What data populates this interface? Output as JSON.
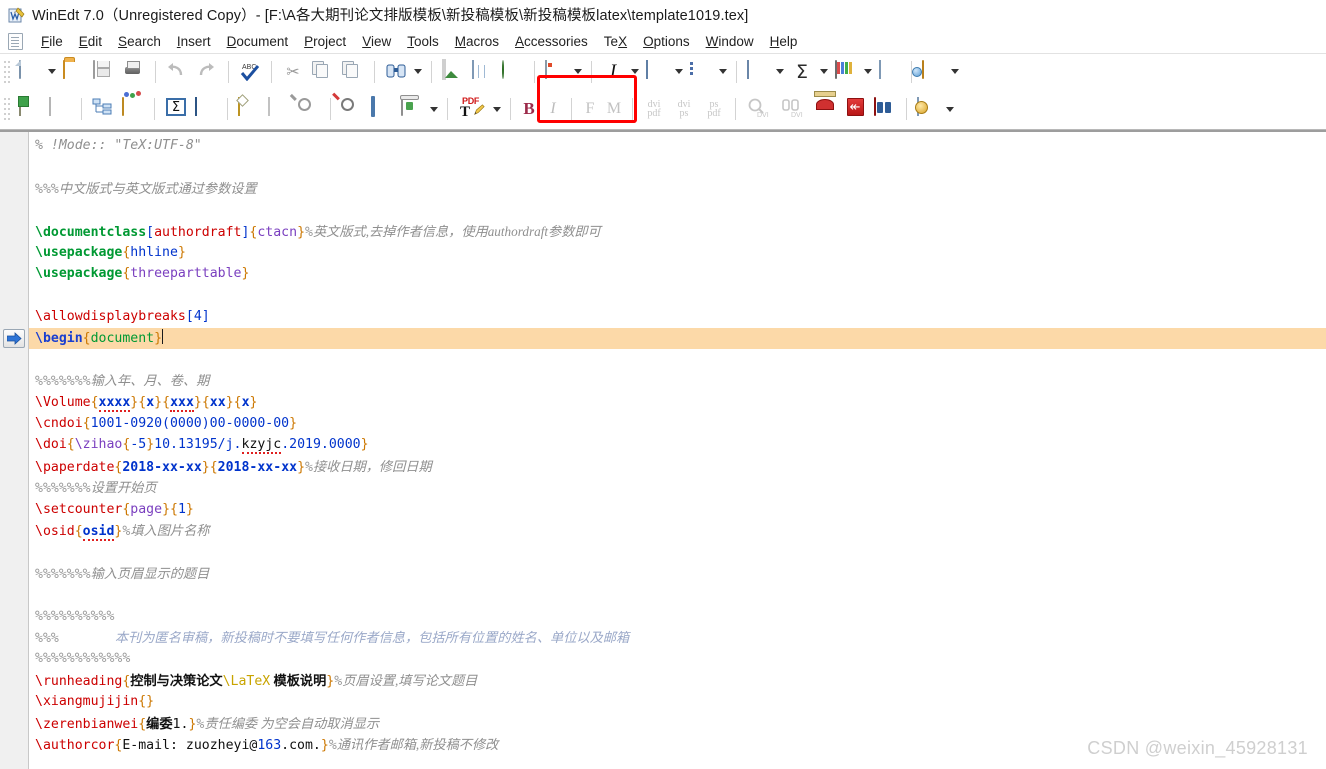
{
  "window": {
    "title": "WinEdt 7.0（Unregistered Copy）- [F:\\A各大期刊论文排版模板\\新投稿模板\\新投稿模板latex\\template1019.tex]",
    "app_icon": "winedt-icon"
  },
  "menubar": {
    "doc_icon": "document-icon",
    "items": [
      {
        "label": "File",
        "accel": "F"
      },
      {
        "label": "Edit",
        "accel": "E"
      },
      {
        "label": "Search",
        "accel": "S"
      },
      {
        "label": "Insert",
        "accel": "I"
      },
      {
        "label": "Document",
        "accel": "D"
      },
      {
        "label": "Project",
        "accel": "P"
      },
      {
        "label": "View",
        "accel": "V"
      },
      {
        "label": "Tools",
        "accel": "T"
      },
      {
        "label": "Macros",
        "accel": "M"
      },
      {
        "label": "Accessories",
        "accel": "A"
      },
      {
        "label": "TeX",
        "accel": "X"
      },
      {
        "label": "Options",
        "accel": "O"
      },
      {
        "label": "Window",
        "accel": "W"
      },
      {
        "label": "Help",
        "accel": "H"
      }
    ]
  },
  "toolbar_row1": {
    "buttons": [
      {
        "name": "new-document-button",
        "icon": "new-page-icon",
        "dropdown": true
      },
      {
        "name": "open-document-button",
        "icon": "open-folder-icon",
        "dropdown": false
      },
      {
        "name": "save-document-button",
        "icon": "save-disk-icon",
        "dropdown": false
      },
      {
        "name": "print-document-button",
        "icon": "printer-icon",
        "dropdown": false
      },
      {
        "name": "undo-button",
        "icon": "undo-arrow-icon",
        "dropdown": false
      },
      {
        "name": "redo-button",
        "icon": "redo-arrow-icon",
        "dropdown": false
      },
      {
        "name": "spell-check-button",
        "icon": "abc-checkmark-icon",
        "dropdown": false
      },
      {
        "name": "cut-button",
        "icon": "scissors-icon",
        "dropdown": false
      },
      {
        "name": "copy-button",
        "icon": "copy-pages-icon",
        "dropdown": false
      },
      {
        "name": "paste-button",
        "icon": "clipboard-icon",
        "dropdown": false
      },
      {
        "name": "find-replace-button",
        "icon": "binoculars-icon",
        "dropdown": true
      },
      {
        "name": "insert-image-button",
        "icon": "picture-icon",
        "dropdown": false
      },
      {
        "name": "insert-table-button",
        "icon": "table-icon",
        "dropdown": false
      },
      {
        "name": "insert-url-button",
        "icon": "globe-link-icon",
        "dropdown": false
      },
      {
        "name": "document-style-button",
        "icon": "styled-doc-icon",
        "dropdown": true
      },
      {
        "name": "italic-style-button",
        "icon": "italic-i-icon",
        "dropdown": true
      },
      {
        "name": "paragraph-align-button",
        "icon": "align-lines-icon",
        "dropdown": true
      },
      {
        "name": "list-environment-button",
        "icon": "bullet-list-icon",
        "dropdown": true
      },
      {
        "name": "tabular-wizard-button",
        "icon": "grid-table-icon",
        "dropdown": true
      },
      {
        "name": "math-symbol-button",
        "icon": "sigma-icon",
        "dropdown": true
      },
      {
        "name": "bibliography-button",
        "icon": "open-book-icon",
        "dropdown": true
      },
      {
        "name": "notes-button",
        "icon": "note-lines-icon",
        "dropdown": false
      },
      {
        "name": "project-folder-button",
        "icon": "folder-explore-icon",
        "dropdown": true
      }
    ]
  },
  "toolbar_row2": {
    "buttons": [
      {
        "name": "new-tex-document-button",
        "icon": "new-doc-plus-icon",
        "label": "",
        "state": "enabled"
      },
      {
        "name": "duplicate-doc-button",
        "icon": "gray-doc-icon",
        "label": "",
        "state": "disabled"
      },
      {
        "name": "document-tree-button",
        "icon": "tree-outline-icon",
        "label": "",
        "state": "enabled"
      },
      {
        "name": "package-wizard-button",
        "icon": "open-box-icon",
        "label": "",
        "state": "enabled"
      },
      {
        "name": "math-mode-button",
        "icon": "sigma-box-icon",
        "label": "",
        "state": "enabled"
      },
      {
        "name": "tex-preview-button",
        "icon": "blue-window-a-icon",
        "label": "",
        "state": "enabled"
      },
      {
        "name": "insert-table-wizard",
        "icon": "gold-grid-icon",
        "label": "",
        "state": "enabled"
      },
      {
        "name": "table-tools-button",
        "icon": "gray-grid-icon",
        "label": "",
        "state": "disabled"
      },
      {
        "name": "zoom-button",
        "icon": "magnifier-icon",
        "label": "",
        "state": "disabled"
      },
      {
        "name": "find-error-button",
        "icon": "magnifier-red-icon",
        "label": "",
        "state": "enabled"
      },
      {
        "name": "log-window-button",
        "icon": "blue-screen-icon",
        "label": "",
        "state": "enabled"
      },
      {
        "name": "clean-aux-button",
        "icon": "recycle-bin-icon",
        "label": "",
        "state": "enabled",
        "dropdown": true
      },
      {
        "name": "pdftexify-button",
        "icon": "pdf-texify-icon",
        "label": "PDF",
        "state": "enabled",
        "dropdown": true,
        "highlighted": true
      },
      {
        "name": "bibtex-button",
        "icon": "bold-b-icon",
        "label": "B",
        "state": "enabled"
      },
      {
        "name": "index-button",
        "icon": "italic-i-icon",
        "label": "I",
        "state": "disabled"
      },
      {
        "name": "makeindex-f-button",
        "icon": "letter-f-icon",
        "label": "F",
        "state": "disabled"
      },
      {
        "name": "makeindex-m-button",
        "icon": "letter-m-icon",
        "label": "M",
        "state": "disabled"
      },
      {
        "name": "dvi-to-pdf-button",
        "icon": "dvi-pdf-icon",
        "label": "dvi pdf",
        "state": "disabled"
      },
      {
        "name": "dvi-to-ps-button",
        "icon": "dvi-ps-icon",
        "label": "dvi ps",
        "state": "disabled"
      },
      {
        "name": "ps-to-pdf-button",
        "icon": "ps-pdf-icon",
        "label": "ps pdf",
        "state": "disabled"
      },
      {
        "name": "dvi-preview-button",
        "icon": "magnifier-dvi-icon",
        "label": "DVI",
        "state": "disabled"
      },
      {
        "name": "dvi-search-button",
        "icon": "binoculars-dvi-icon",
        "label": "DVI",
        "state": "disabled"
      },
      {
        "name": "dvi-print-button",
        "icon": "dvi-print-icon",
        "label": "",
        "state": "enabled"
      },
      {
        "name": "pdf-preview-button",
        "icon": "pdf-red-icon",
        "label": "",
        "state": "enabled"
      },
      {
        "name": "pdf-search-button",
        "icon": "pdf-binoculars-icon",
        "label": "",
        "state": "enabled"
      },
      {
        "name": "execution-modes-button",
        "icon": "gear-doc-icon",
        "label": "",
        "state": "enabled",
        "dropdown": true
      }
    ]
  },
  "editor": {
    "current_line_index": 8,
    "gutter_marker_icon": "blue-arrow-icon",
    "lines": [
      {
        "i": 0,
        "segments": [
          {
            "t": "% !Mode:: \"TeX:UTF-8\"",
            "c": "cmt"
          }
        ]
      },
      {
        "i": 1,
        "segments": []
      },
      {
        "i": 2,
        "segments": [
          {
            "t": "%%%",
            "c": "pct"
          },
          {
            "t": "中文版式与英文版式通过参数设置",
            "c": "cmt-zh"
          }
        ]
      },
      {
        "i": 3,
        "segments": []
      },
      {
        "i": 4,
        "segments": [
          {
            "t": "\\documentclass",
            "c": "cmd-g"
          },
          {
            "t": "[",
            "c": "brk"
          },
          {
            "t": "authordraft",
            "c": "opt"
          },
          {
            "t": "]",
            "c": "brk"
          },
          {
            "t": "{",
            "c": "brace"
          },
          {
            "t": "ctacn",
            "c": "arg"
          },
          {
            "t": "}",
            "c": "brace"
          },
          {
            "t": "%",
            "c": "pct"
          },
          {
            "t": "英文版式,去掉作者信息，使用authordraft参数即可",
            "c": "cmt-zh"
          }
        ]
      },
      {
        "i": 5,
        "segments": [
          {
            "t": "\\usepackage",
            "c": "cmd-g"
          },
          {
            "t": "{",
            "c": "brace"
          },
          {
            "t": "hhline",
            "c": "brk"
          },
          {
            "t": "}",
            "c": "brace"
          }
        ]
      },
      {
        "i": 6,
        "segments": [
          {
            "t": "\\usepackage",
            "c": "cmd-g"
          },
          {
            "t": "{",
            "c": "brace"
          },
          {
            "t": "threeparttable",
            "c": "arg"
          },
          {
            "t": "}",
            "c": "brace"
          }
        ]
      },
      {
        "i": 7,
        "segments": []
      },
      {
        "i": 8,
        "segments": [
          {
            "t": "\\allowdisplaybreaks",
            "c": "cmd"
          },
          {
            "t": "[",
            "c": "brk"
          },
          {
            "t": "4",
            "c": "num"
          },
          {
            "t": "]",
            "c": "brk"
          }
        ]
      },
      {
        "i": 9,
        "segments": [
          {
            "t": "\\begin",
            "c": "blu"
          },
          {
            "t": "{",
            "c": "brace"
          },
          {
            "t": "document",
            "c": "grn"
          },
          {
            "t": "}",
            "c": "brace"
          }
        ],
        "current": true,
        "caret": true
      },
      {
        "i": 10,
        "segments": []
      },
      {
        "i": 11,
        "segments": [
          {
            "t": "%%%%%%%",
            "c": "pct"
          },
          {
            "t": "输入年、月、卷、期",
            "c": "cmt-zh"
          }
        ]
      },
      {
        "i": 12,
        "segments": [
          {
            "t": "\\Volume",
            "c": "cmd"
          },
          {
            "t": "{",
            "c": "brace"
          },
          {
            "t": "xxxx",
            "c": "argb",
            "spell": true
          },
          {
            "t": "}",
            "c": "brace"
          },
          {
            "t": "{",
            "c": "brace"
          },
          {
            "t": "x",
            "c": "argb"
          },
          {
            "t": "}",
            "c": "brace"
          },
          {
            "t": "{",
            "c": "brace"
          },
          {
            "t": "xxx",
            "c": "argb",
            "spell": true
          },
          {
            "t": "}",
            "c": "brace"
          },
          {
            "t": "{",
            "c": "brace"
          },
          {
            "t": "xx",
            "c": "argb"
          },
          {
            "t": "}",
            "c": "brace"
          },
          {
            "t": "{",
            "c": "brace"
          },
          {
            "t": "x",
            "c": "argb"
          },
          {
            "t": "}",
            "c": "brace"
          }
        ]
      },
      {
        "i": 13,
        "segments": [
          {
            "t": "\\cndoi",
            "c": "cmd"
          },
          {
            "t": "{",
            "c": "brace"
          },
          {
            "t": "1001-0920(0000)00-0000-00",
            "c": "num"
          },
          {
            "t": "}",
            "c": "brace"
          }
        ]
      },
      {
        "i": 14,
        "segments": [
          {
            "t": "\\doi",
            "c": "cmd"
          },
          {
            "t": "{",
            "c": "brace"
          },
          {
            "t": "\\zihao",
            "c": "arg"
          },
          {
            "t": "{",
            "c": "brace"
          },
          {
            "t": "-5",
            "c": "num"
          },
          {
            "t": "}",
            "c": "brace"
          },
          {
            "t": "10.13195/j.",
            "c": "num"
          },
          {
            "t": "kzyjc",
            "c": "plain",
            "spell": true
          },
          {
            "t": ".2019.0000",
            "c": "num"
          },
          {
            "t": "}",
            "c": "brace"
          }
        ]
      },
      {
        "i": 15,
        "segments": [
          {
            "t": "\\paperdate",
            "c": "cmd"
          },
          {
            "t": "{",
            "c": "brace"
          },
          {
            "t": "2018-xx-xx",
            "c": "argb"
          },
          {
            "t": "}",
            "c": "brace"
          },
          {
            "t": "{",
            "c": "brace"
          },
          {
            "t": "2018-xx-xx",
            "c": "argb"
          },
          {
            "t": "}",
            "c": "brace"
          },
          {
            "t": "%",
            "c": "pct"
          },
          {
            "t": "接收日期，修回日期",
            "c": "cmt-zh"
          }
        ]
      },
      {
        "i": 16,
        "segments": [
          {
            "t": "%%%%%%%",
            "c": "pct"
          },
          {
            "t": "设置开始页",
            "c": "cmt-zh"
          }
        ]
      },
      {
        "i": 17,
        "segments": [
          {
            "t": "\\setcounter",
            "c": "cmd"
          },
          {
            "t": "{",
            "c": "brace"
          },
          {
            "t": "page",
            "c": "arg"
          },
          {
            "t": "}",
            "c": "brace"
          },
          {
            "t": "{",
            "c": "brace"
          },
          {
            "t": "1",
            "c": "num"
          },
          {
            "t": "}",
            "c": "brace"
          }
        ]
      },
      {
        "i": 18,
        "segments": [
          {
            "t": "\\osid",
            "c": "cmd"
          },
          {
            "t": "{",
            "c": "brace"
          },
          {
            "t": "osid",
            "c": "argb",
            "spell": true
          },
          {
            "t": "}",
            "c": "brace"
          },
          {
            "t": "%",
            "c": "pct"
          },
          {
            "t": "填入图片名称",
            "c": "cmt-zh"
          }
        ]
      },
      {
        "i": 19,
        "segments": []
      },
      {
        "i": 20,
        "segments": [
          {
            "t": "%%%%%%%",
            "c": "pct"
          },
          {
            "t": "输入页眉显示的题目",
            "c": "cmt-zh"
          }
        ]
      },
      {
        "i": 21,
        "segments": []
      },
      {
        "i": 22,
        "segments": [
          {
            "t": "%%%%%%%%%%",
            "c": "pct"
          }
        ]
      },
      {
        "i": 23,
        "segments": [
          {
            "t": "%%%",
            "c": "pct"
          },
          {
            "t": "                 本刊为匿名审稿，新投稿时不要填写任何作者信息，包括所有位置的姓名、单位以及邮箱",
            "c": "anon"
          }
        ]
      },
      {
        "i": 24,
        "segments": [
          {
            "t": "%%%%%%%%%%%%",
            "c": "pct"
          }
        ]
      },
      {
        "i": 25,
        "segments": [
          {
            "t": "\\runheading",
            "c": "cmd"
          },
          {
            "t": "{",
            "c": "brace"
          },
          {
            "t": "控制与决策论文",
            "c": "zhblk"
          },
          {
            "t": "\\LaTeX",
            "c": "latex-y"
          },
          {
            "t": " 模板说明",
            "c": "zhblk"
          },
          {
            "t": "}",
            "c": "brace"
          },
          {
            "t": "%",
            "c": "pct"
          },
          {
            "t": "页眉设置,填写论文题目",
            "c": "cmt-zh"
          }
        ]
      },
      {
        "i": 26,
        "segments": [
          {
            "t": "\\xiangmujijin",
            "c": "cmd"
          },
          {
            "t": "{",
            "c": "brace"
          },
          {
            "t": "}",
            "c": "brace"
          }
        ]
      },
      {
        "i": 27,
        "segments": [
          {
            "t": "\\zerenbianwei",
            "c": "cmd"
          },
          {
            "t": "{",
            "c": "brace"
          },
          {
            "t": "编委",
            "c": "zhblk"
          },
          {
            "t": "1.",
            "c": "plain"
          },
          {
            "t": "}",
            "c": "brace"
          },
          {
            "t": "%",
            "c": "pct"
          },
          {
            "t": "责任编委 为空会自动取消显示",
            "c": "cmt-zh"
          }
        ]
      },
      {
        "i": 28,
        "segments": [
          {
            "t": "\\authorcor",
            "c": "cmd"
          },
          {
            "t": "{",
            "c": "brace"
          },
          {
            "t": "E-mail: zuozheyi@",
            "c": "plain"
          },
          {
            "t": "163",
            "c": "num"
          },
          {
            "t": ".com.",
            "c": "plain"
          },
          {
            "t": "}",
            "c": "brace"
          },
          {
            "t": "%",
            "c": "pct"
          },
          {
            "t": "通讯作者邮箱,新投稿不修改",
            "c": "cmt-zh"
          }
        ]
      }
    ]
  },
  "watermark": {
    "text": "CSDN @weixin_45928131"
  },
  "colors": {
    "highlight_line": "#fcd9a8",
    "attention_box": "#ff0000",
    "command_red": "#cc0000",
    "command_green": "#009933",
    "brace_orange": "#cc7700",
    "argument_blue": "#0033cc",
    "comment_gray": "#8f8f8f",
    "anon_note": "#9aa8c8"
  }
}
